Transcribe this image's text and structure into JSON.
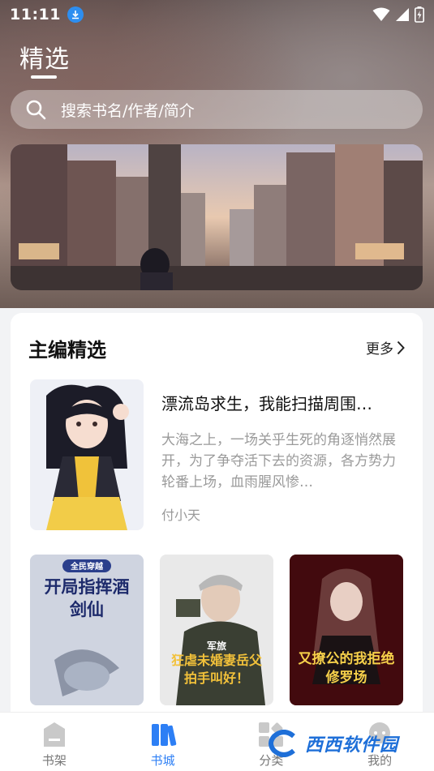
{
  "status_bar": {
    "time": "11:11"
  },
  "header": {
    "title": "精选"
  },
  "search": {
    "placeholder": "搜索书名/作者/简介"
  },
  "section": {
    "title": "主编精选",
    "more_label": "更多"
  },
  "featured_book": {
    "title": "漂流岛求生，我能扫描周围…",
    "description": "大海之上，一场关乎生死的角逐悄然展开，为了争夺活下去的资源，各方势力轮番上场，血雨腥风惨…",
    "author": "付小天"
  },
  "grid_books": [
    {
      "cover_title": "开局指挥酒剑仙",
      "cover_badge": "全民穿越"
    },
    {
      "cover_title": "狂虐未婚妻岳父拍手叫好！",
      "cover_badge": "军旅"
    },
    {
      "cover_title": "又撩公的我拒绝修罗场",
      "cover_badge": ""
    }
  ],
  "bottom_nav": {
    "items": [
      {
        "label": "书架",
        "icon": "bookshelf-icon",
        "active": false
      },
      {
        "label": "书城",
        "icon": "bookstore-icon",
        "active": true
      },
      {
        "label": "分类",
        "icon": "category-icon",
        "active": false
      },
      {
        "label": "我的",
        "icon": "profile-icon",
        "active": false
      }
    ]
  },
  "watermark": {
    "text": "西西软件园"
  },
  "colors": {
    "accent": "#2d7ff5",
    "muted_text": "#9a9a9a"
  }
}
